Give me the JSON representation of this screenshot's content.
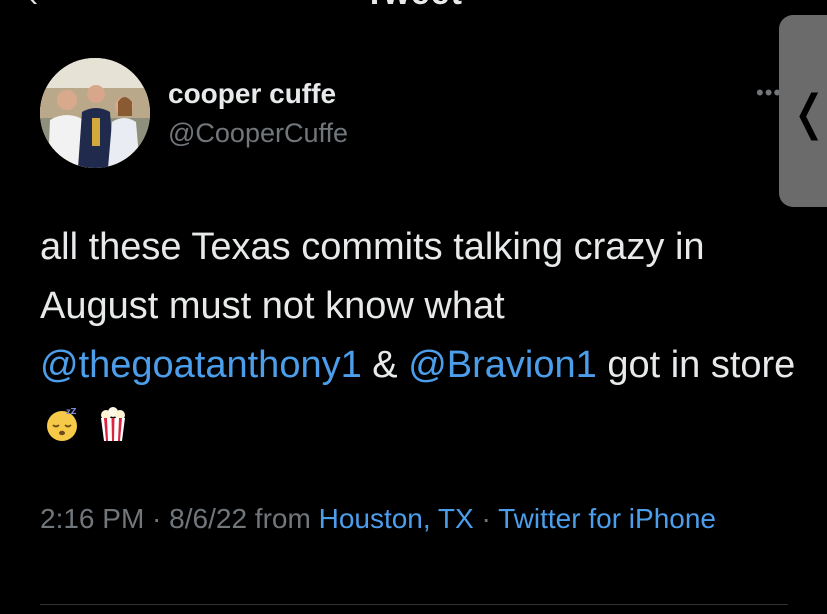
{
  "header": {
    "title": "Tweet",
    "back_icon": "chevron-left-icon"
  },
  "tweet": {
    "author": {
      "display_name": "cooper cuffe",
      "handle": "@CooperCuffe",
      "avatar_icon": "user-avatar"
    },
    "more_label": "•••",
    "text_segments": {
      "part1": "all these Texas commits talking crazy in August must not know what ",
      "mention1": "@thegoatanthony1",
      "part2": " & ",
      "mention2": "@Bravion1",
      "part3": " got in store"
    },
    "emojis": [
      "sleeping-face-emoji",
      "popcorn-emoji"
    ],
    "meta": {
      "time": "2:16 PM",
      "sep1": " · ",
      "date": "8/6/22",
      "from_label": " from ",
      "location": "Houston, TX",
      "sep2": " · ",
      "client": "Twitter for iPhone"
    }
  },
  "side_handle": {
    "icon": "chevron-left-icon",
    "glyph": "❬"
  },
  "colors": {
    "background": "#000000",
    "text": "#e7e9ea",
    "secondary": "#71767b",
    "link": "#4c9eeb",
    "handle_bg": "#6b6b6b"
  }
}
